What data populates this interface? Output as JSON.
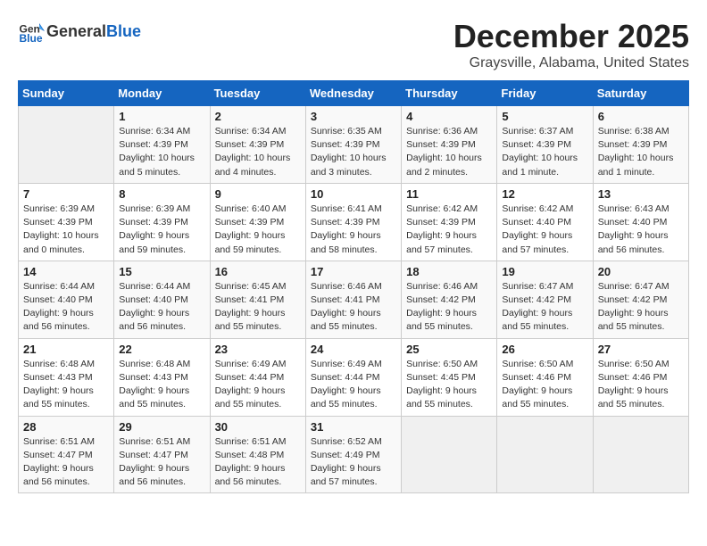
{
  "header": {
    "logo_general": "General",
    "logo_blue": "Blue",
    "month_title": "December 2025",
    "location": "Graysville, Alabama, United States"
  },
  "weekdays": [
    "Sunday",
    "Monday",
    "Tuesday",
    "Wednesday",
    "Thursday",
    "Friday",
    "Saturday"
  ],
  "weeks": [
    [
      {
        "day": "",
        "empty": true
      },
      {
        "day": "1",
        "sunrise": "Sunrise: 6:34 AM",
        "sunset": "Sunset: 4:39 PM",
        "daylight": "Daylight: 10 hours and 5 minutes."
      },
      {
        "day": "2",
        "sunrise": "Sunrise: 6:34 AM",
        "sunset": "Sunset: 4:39 PM",
        "daylight": "Daylight: 10 hours and 4 minutes."
      },
      {
        "day": "3",
        "sunrise": "Sunrise: 6:35 AM",
        "sunset": "Sunset: 4:39 PM",
        "daylight": "Daylight: 10 hours and 3 minutes."
      },
      {
        "day": "4",
        "sunrise": "Sunrise: 6:36 AM",
        "sunset": "Sunset: 4:39 PM",
        "daylight": "Daylight: 10 hours and 2 minutes."
      },
      {
        "day": "5",
        "sunrise": "Sunrise: 6:37 AM",
        "sunset": "Sunset: 4:39 PM",
        "daylight": "Daylight: 10 hours and 1 minute."
      },
      {
        "day": "6",
        "sunrise": "Sunrise: 6:38 AM",
        "sunset": "Sunset: 4:39 PM",
        "daylight": "Daylight: 10 hours and 1 minute."
      }
    ],
    [
      {
        "day": "7",
        "sunrise": "Sunrise: 6:39 AM",
        "sunset": "Sunset: 4:39 PM",
        "daylight": "Daylight: 10 hours and 0 minutes."
      },
      {
        "day": "8",
        "sunrise": "Sunrise: 6:39 AM",
        "sunset": "Sunset: 4:39 PM",
        "daylight": "Daylight: 9 hours and 59 minutes."
      },
      {
        "day": "9",
        "sunrise": "Sunrise: 6:40 AM",
        "sunset": "Sunset: 4:39 PM",
        "daylight": "Daylight: 9 hours and 59 minutes."
      },
      {
        "day": "10",
        "sunrise": "Sunrise: 6:41 AM",
        "sunset": "Sunset: 4:39 PM",
        "daylight": "Daylight: 9 hours and 58 minutes."
      },
      {
        "day": "11",
        "sunrise": "Sunrise: 6:42 AM",
        "sunset": "Sunset: 4:39 PM",
        "daylight": "Daylight: 9 hours and 57 minutes."
      },
      {
        "day": "12",
        "sunrise": "Sunrise: 6:42 AM",
        "sunset": "Sunset: 4:40 PM",
        "daylight": "Daylight: 9 hours and 57 minutes."
      },
      {
        "day": "13",
        "sunrise": "Sunrise: 6:43 AM",
        "sunset": "Sunset: 4:40 PM",
        "daylight": "Daylight: 9 hours and 56 minutes."
      }
    ],
    [
      {
        "day": "14",
        "sunrise": "Sunrise: 6:44 AM",
        "sunset": "Sunset: 4:40 PM",
        "daylight": "Daylight: 9 hours and 56 minutes."
      },
      {
        "day": "15",
        "sunrise": "Sunrise: 6:44 AM",
        "sunset": "Sunset: 4:40 PM",
        "daylight": "Daylight: 9 hours and 56 minutes."
      },
      {
        "day": "16",
        "sunrise": "Sunrise: 6:45 AM",
        "sunset": "Sunset: 4:41 PM",
        "daylight": "Daylight: 9 hours and 55 minutes."
      },
      {
        "day": "17",
        "sunrise": "Sunrise: 6:46 AM",
        "sunset": "Sunset: 4:41 PM",
        "daylight": "Daylight: 9 hours and 55 minutes."
      },
      {
        "day": "18",
        "sunrise": "Sunrise: 6:46 AM",
        "sunset": "Sunset: 4:42 PM",
        "daylight": "Daylight: 9 hours and 55 minutes."
      },
      {
        "day": "19",
        "sunrise": "Sunrise: 6:47 AM",
        "sunset": "Sunset: 4:42 PM",
        "daylight": "Daylight: 9 hours and 55 minutes."
      },
      {
        "day": "20",
        "sunrise": "Sunrise: 6:47 AM",
        "sunset": "Sunset: 4:42 PM",
        "daylight": "Daylight: 9 hours and 55 minutes."
      }
    ],
    [
      {
        "day": "21",
        "sunrise": "Sunrise: 6:48 AM",
        "sunset": "Sunset: 4:43 PM",
        "daylight": "Daylight: 9 hours and 55 minutes."
      },
      {
        "day": "22",
        "sunrise": "Sunrise: 6:48 AM",
        "sunset": "Sunset: 4:43 PM",
        "daylight": "Daylight: 9 hours and 55 minutes."
      },
      {
        "day": "23",
        "sunrise": "Sunrise: 6:49 AM",
        "sunset": "Sunset: 4:44 PM",
        "daylight": "Daylight: 9 hours and 55 minutes."
      },
      {
        "day": "24",
        "sunrise": "Sunrise: 6:49 AM",
        "sunset": "Sunset: 4:44 PM",
        "daylight": "Daylight: 9 hours and 55 minutes."
      },
      {
        "day": "25",
        "sunrise": "Sunrise: 6:50 AM",
        "sunset": "Sunset: 4:45 PM",
        "daylight": "Daylight: 9 hours and 55 minutes."
      },
      {
        "day": "26",
        "sunrise": "Sunrise: 6:50 AM",
        "sunset": "Sunset: 4:46 PM",
        "daylight": "Daylight: 9 hours and 55 minutes."
      },
      {
        "day": "27",
        "sunrise": "Sunrise: 6:50 AM",
        "sunset": "Sunset: 4:46 PM",
        "daylight": "Daylight: 9 hours and 55 minutes."
      }
    ],
    [
      {
        "day": "28",
        "sunrise": "Sunrise: 6:51 AM",
        "sunset": "Sunset: 4:47 PM",
        "daylight": "Daylight: 9 hours and 56 minutes."
      },
      {
        "day": "29",
        "sunrise": "Sunrise: 6:51 AM",
        "sunset": "Sunset: 4:47 PM",
        "daylight": "Daylight: 9 hours and 56 minutes."
      },
      {
        "day": "30",
        "sunrise": "Sunrise: 6:51 AM",
        "sunset": "Sunset: 4:48 PM",
        "daylight": "Daylight: 9 hours and 56 minutes."
      },
      {
        "day": "31",
        "sunrise": "Sunrise: 6:52 AM",
        "sunset": "Sunset: 4:49 PM",
        "daylight": "Daylight: 9 hours and 57 minutes."
      },
      {
        "day": "",
        "empty": true
      },
      {
        "day": "",
        "empty": true
      },
      {
        "day": "",
        "empty": true
      }
    ]
  ]
}
